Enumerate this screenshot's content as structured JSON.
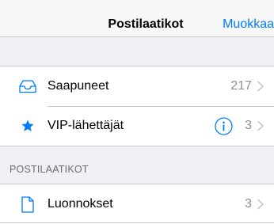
{
  "navbar": {
    "title": "Postilaatikot",
    "edit_label": "Muokkaa",
    "accent_color": "#007aff"
  },
  "mailboxes": [
    {
      "label": "Saapuneet",
      "count": "217",
      "icon": "inbox-tray-icon"
    },
    {
      "label": "VIP-lähettäjät",
      "count": "3",
      "icon": "star-icon"
    }
  ],
  "section": {
    "header": "POSTILAATIKOT"
  },
  "folders": [
    {
      "label": "Luonnokset",
      "count": "3",
      "icon": "document-icon"
    }
  ]
}
